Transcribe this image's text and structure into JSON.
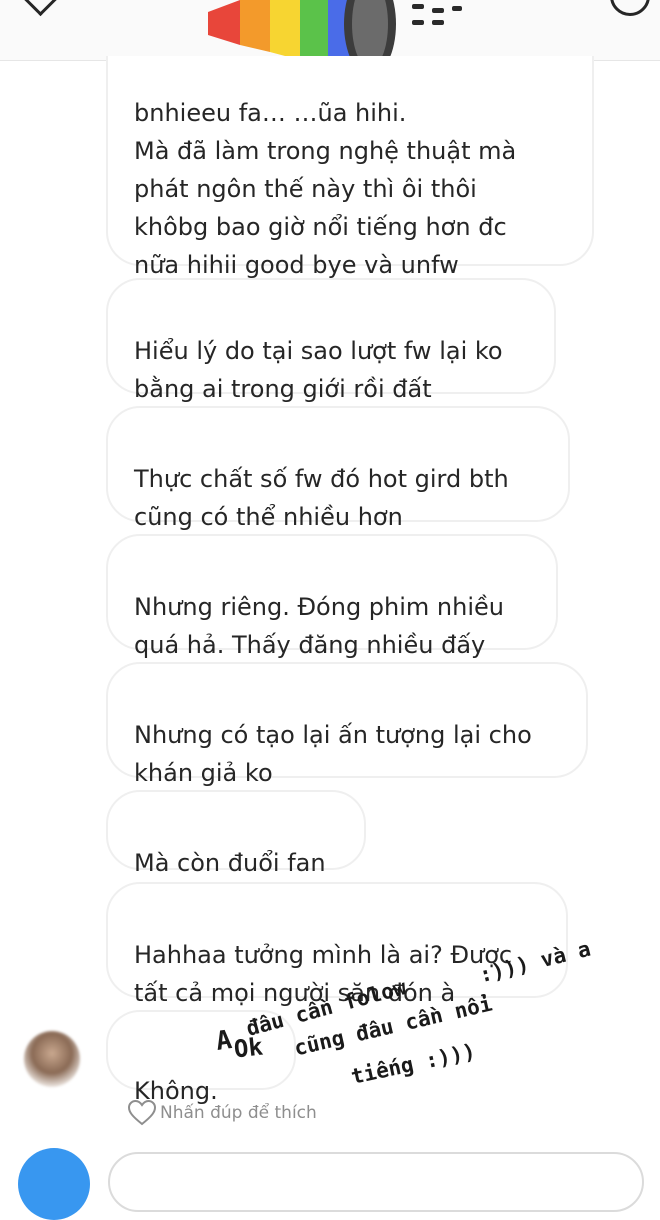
{
  "thread": {
    "messages": [
      {
        "text": "bnhieeu fa… …ũa hihi.\nMà đã làm trong nghệ thuật mà\nphát ngôn thế này thì ôi thôi\nkhôbg bao giờ nổi tiếng hơn đc\nnữa hihii good bye và unfw"
      },
      {
        "text": "Hiểu lý do tại sao lượt fw lại ko\nbằng ai trong giới rồi đất"
      },
      {
        "text": "Thực chất số fw đó hot gird bth\ncũng có thể nhiều hơn"
      },
      {
        "text": "Nhưng riêng. Đóng phim nhiều\nquá hả. Thấy đăng nhiều đấy"
      },
      {
        "text": "Nhưng có tạo lại ấn tượng lại cho\nkhán giả ko"
      },
      {
        "text": "Mà còn đuổi fan"
      },
      {
        "text": "Hahhaa tưởng mình là ai? Được\ntất cả mọi người săn đón à"
      },
      {
        "text": "Không."
      }
    ],
    "like_hint": "Nhấn đúp để thích"
  },
  "overlay_handwriting": {
    "line1": ":))) và a",
    "line2": "đâu cần folow",
    "line3": "cũng đâu cần nổi",
    "line4": "tiếng :)))",
    "line5": "A",
    "line6": "Ok"
  },
  "colors": {
    "bubble_border": "#efefef",
    "text": "#262626",
    "muted": "#8e8e8e",
    "accent": "#3897f0"
  },
  "icons": [
    "back-arrow-icon",
    "info-icon",
    "megaphone-sticker",
    "heart-icon",
    "camera-icon"
  ]
}
